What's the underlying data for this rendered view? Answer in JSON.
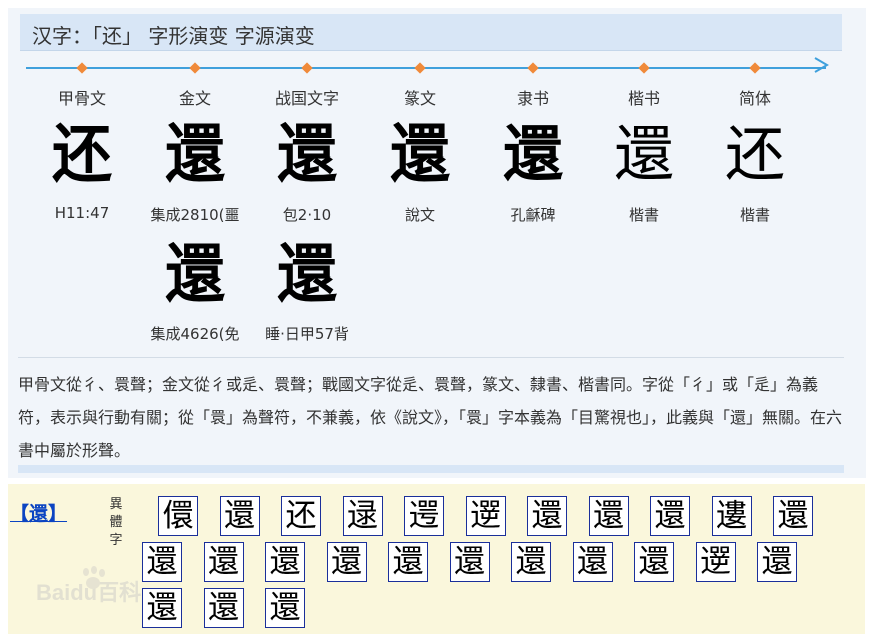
{
  "title": "汉字：「还」 字形演变 字源演变",
  "eras": [
    "甲骨文",
    "金文",
    "战国文字",
    "篆文",
    "隶书",
    "楷书",
    "简体"
  ],
  "glyphs": {
    "row1": [
      {
        "char": "还",
        "source": "H11:47"
      },
      {
        "char": "還",
        "source": "集成2810(噩"
      },
      {
        "char": "還",
        "source": "包2·10"
      },
      {
        "char": "還",
        "source": "說文"
      },
      {
        "char": "還",
        "source": "孔龢碑"
      },
      {
        "char": "還",
        "source": "楷書"
      },
      {
        "char": "还",
        "source": "楷書"
      }
    ],
    "row2": [
      {
        "char": "還",
        "source": "集成4626(免"
      },
      {
        "char": "還",
        "source": "睡·日甲57背"
      }
    ]
  },
  "description": "甲骨文從彳、睘聲；金文從彳或辵、睘聲；戰國文字從辵、睘聲，篆文、隸書、楷書同。字從「彳」或「辵」為義符，表示與行動有關；從「睘」為聲符，不兼義，依《說文》，「睘」字本義為「目驚視也」，此義與「還」無關。在六書中屬於形聲。",
  "variants": {
    "heading": "【還】",
    "label": "異體字",
    "chars": [
      "儇",
      "還",
      "还",
      "逯",
      "遌",
      "遻",
      "還",
      "還",
      "還",
      "遱",
      "還",
      "還",
      "還",
      "還",
      "還",
      "還",
      "還",
      "還",
      "還",
      "還",
      "遻",
      "還",
      "還",
      "還",
      "還"
    ]
  },
  "watermark": "Baidu百科",
  "colors": {
    "timeline": "#3fa0dc",
    "dot": "#f08a3a",
    "link": "#0b44c2",
    "box_border": "#1a2f9a"
  }
}
